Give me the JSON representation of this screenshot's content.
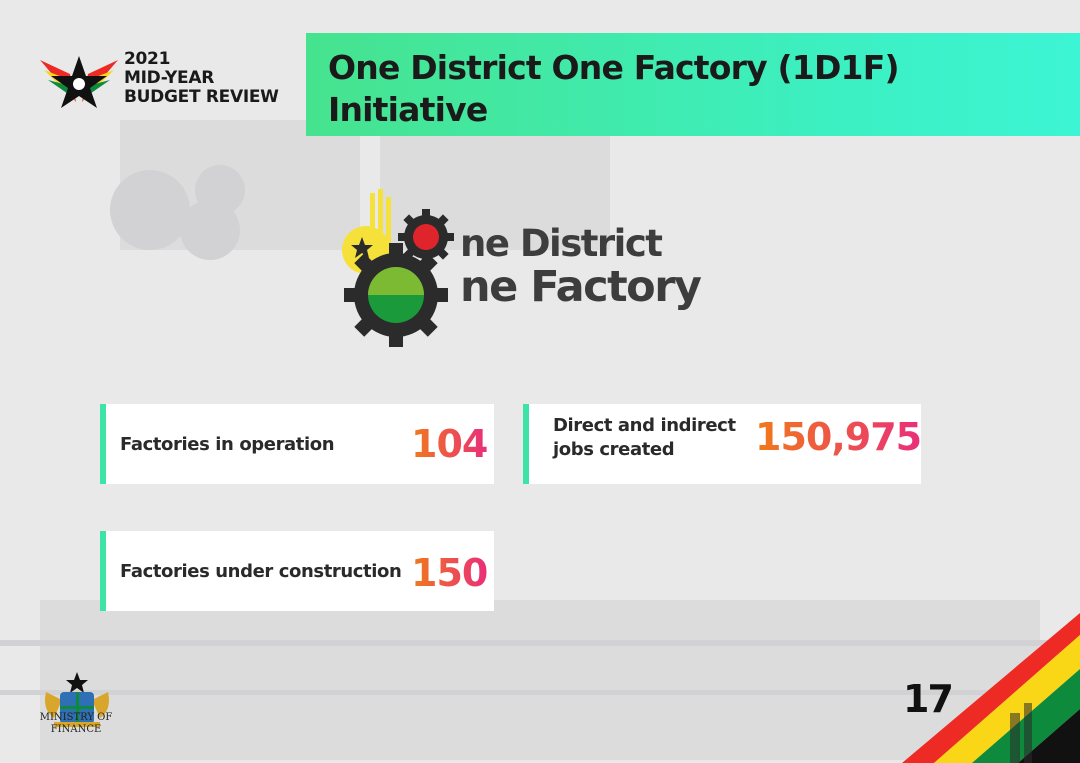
{
  "header": {
    "logo_line1": "2021",
    "logo_line2": "MID-YEAR",
    "logo_line3": "BUDGET REVIEW"
  },
  "title": {
    "line1": "One District One Factory (1D1F)",
    "line2": "Initiative"
  },
  "program_logo": {
    "line1": "ne District",
    "line2": "ne Factory"
  },
  "stats": [
    {
      "label": "Factories in operation",
      "value": "104"
    },
    {
      "label_line1": "Direct and indirect",
      "label_line2": "jobs created",
      "value": "150,975"
    },
    {
      "label": "Factories under construction",
      "value": "150"
    }
  ],
  "footer": {
    "ministry_line1": "MINISTRY OF",
    "ministry_line2": "FINANCE",
    "page_number": "17"
  },
  "colors": {
    "banner_start": "#46e38e",
    "banner_end": "#3cf5d4",
    "card_accent": "#3ee3a6",
    "value_start": "#f07a1a",
    "value_end": "#ea2e7a",
    "ghana_red": "#ee2a24",
    "ghana_gold": "#f9d616",
    "ghana_green": "#0e8a3c"
  },
  "icons": [
    "ghana-star-logo-icon",
    "gear-logo-icon",
    "coat-of-arms-icon",
    "flag-stripes-icon"
  ]
}
